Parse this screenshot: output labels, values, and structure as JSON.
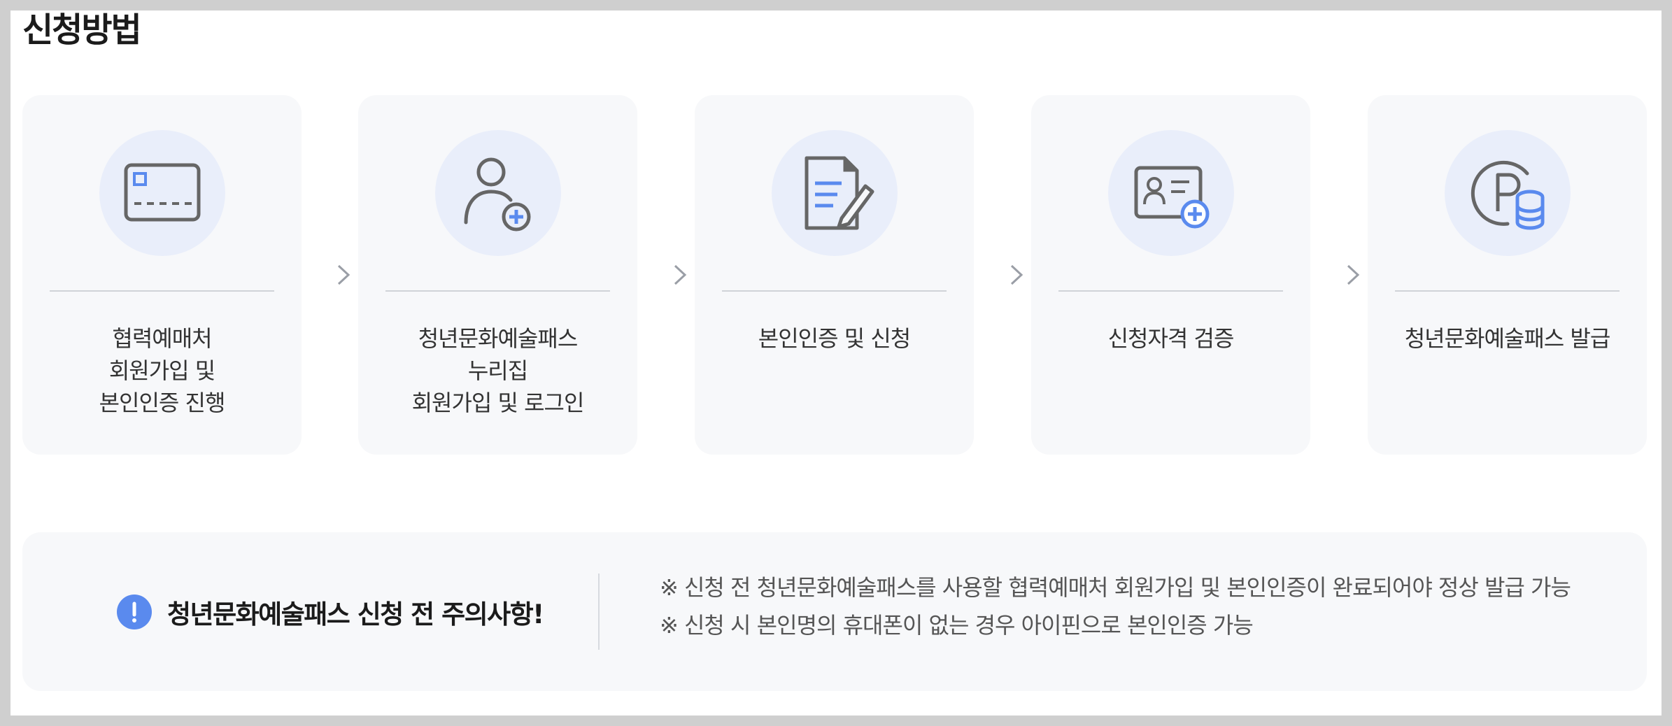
{
  "page": {
    "title": "신청방법"
  },
  "steps": [
    {
      "label": "협력예매처\n회원가입 및\n본인인증 진행",
      "icon": "credit-card-icon"
    },
    {
      "label": "청년문화예술패스\n누리집\n회원가입 및 로그인",
      "icon": "user-add-icon"
    },
    {
      "label": "본인인증 및 신청",
      "icon": "document-edit-icon"
    },
    {
      "label": "신청자격 검증",
      "icon": "id-card-add-icon"
    },
    {
      "label": "청년문화예술패스 발급",
      "icon": "point-coins-icon"
    }
  ],
  "notice": {
    "title": "청년문화예술패스 신청 전 주의사항!",
    "items": [
      "※ 신청 전 청년문화예술패스를 사용할 협력예매처 회원가입 및 본인인증이 완료되어야 정상 발급 가능",
      "※ 신청 시 본인명의 휴대폰이 없는 경우 아이핀으로 본인인증 가능"
    ]
  },
  "colors": {
    "accent": "#5a8aee",
    "icon_gray": "#666666",
    "card_bg": "#f7f8fa",
    "icon_circle_bg": "#e9eefa"
  }
}
